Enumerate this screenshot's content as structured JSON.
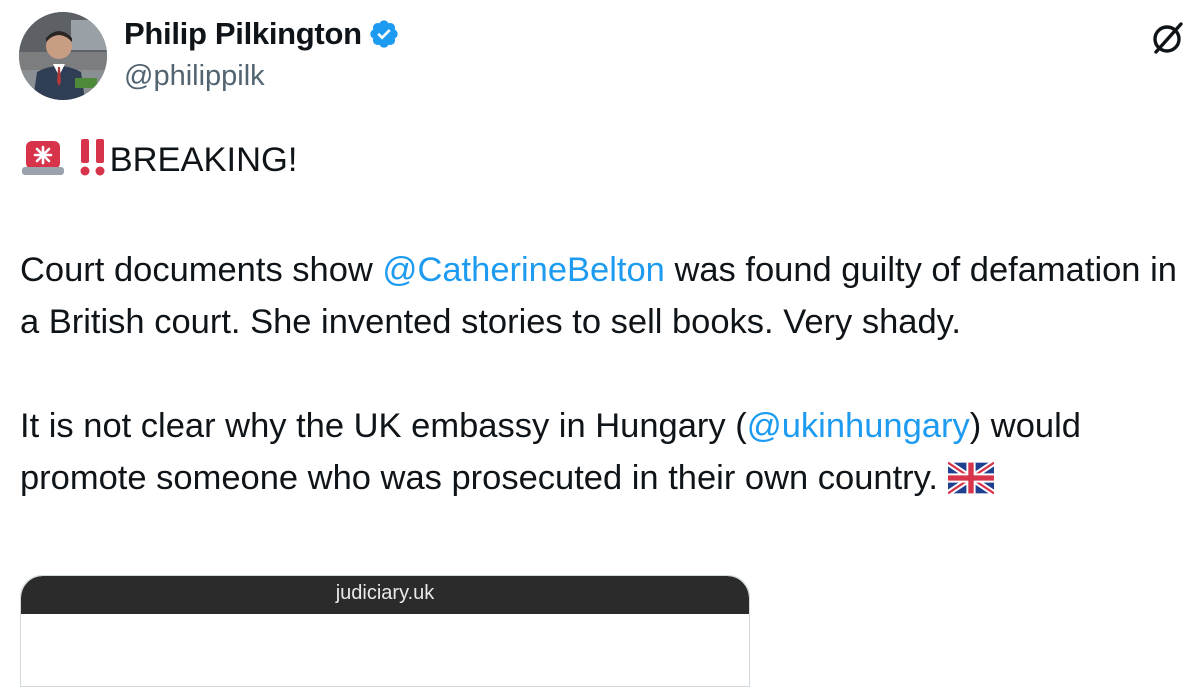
{
  "author": {
    "display_name": "Philip Pilkington",
    "handle": "@philippilk",
    "verified_icon": "verified-badge-icon",
    "avatar_icon": "profile-photo"
  },
  "header": {
    "grok_icon": "grok-icon"
  },
  "tweet": {
    "line_breaking": "BREAKING!",
    "p1_a": "Court documents show ",
    "p1_mention": "@CatherineBelton",
    "p1_b": " was found guilty of defamation in a British court. She invented stories to sell books. Very shady.",
    "p2_a": "It is not clear why the UK embassy in Hungary (",
    "p2_mention": "@ukinhungary",
    "p2_b": ") would promote someone who was prosecuted in their own country. ",
    "emojis": [
      "rotating-light-emoji",
      "double-exclamation-emoji",
      "uk-flag-emoji"
    ]
  },
  "media": {
    "url_label": "judiciary.uk"
  },
  "colors": {
    "text": "#0f1419",
    "secondary": "#536471",
    "link": "#1d9bf0",
    "verified": "#1d9bf0",
    "browser_bar": "#2b2b2b"
  }
}
